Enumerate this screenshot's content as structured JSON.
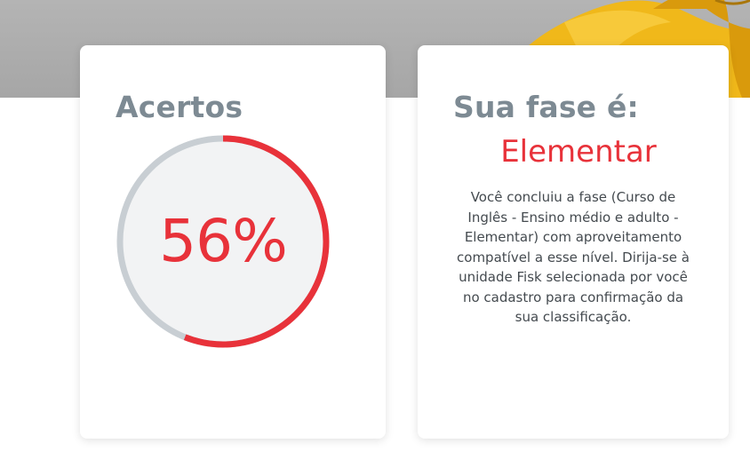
{
  "colors": {
    "accent_red": "#e8323a",
    "title_gray": "#7d8a93",
    "track_gray": "#c8ced3",
    "gauge_fill": "#f2f3f4",
    "hero_gray": "#aaaaaa",
    "hero_yellow": "#f0b81a"
  },
  "score_card": {
    "title": "Acertos",
    "percent_value": 56,
    "percent_label": "56%"
  },
  "phase_card": {
    "title": "Sua fase é:",
    "phase_name": "Elementar",
    "description": "Você concluiu a fase (Curso de Inglês - Ensino médio e adulto - Elementar) com aproveitamento compatível a esse nível. Dirija-se à unidade Fisk selecionada por você no cadastro para confirmação da sua classificação."
  }
}
